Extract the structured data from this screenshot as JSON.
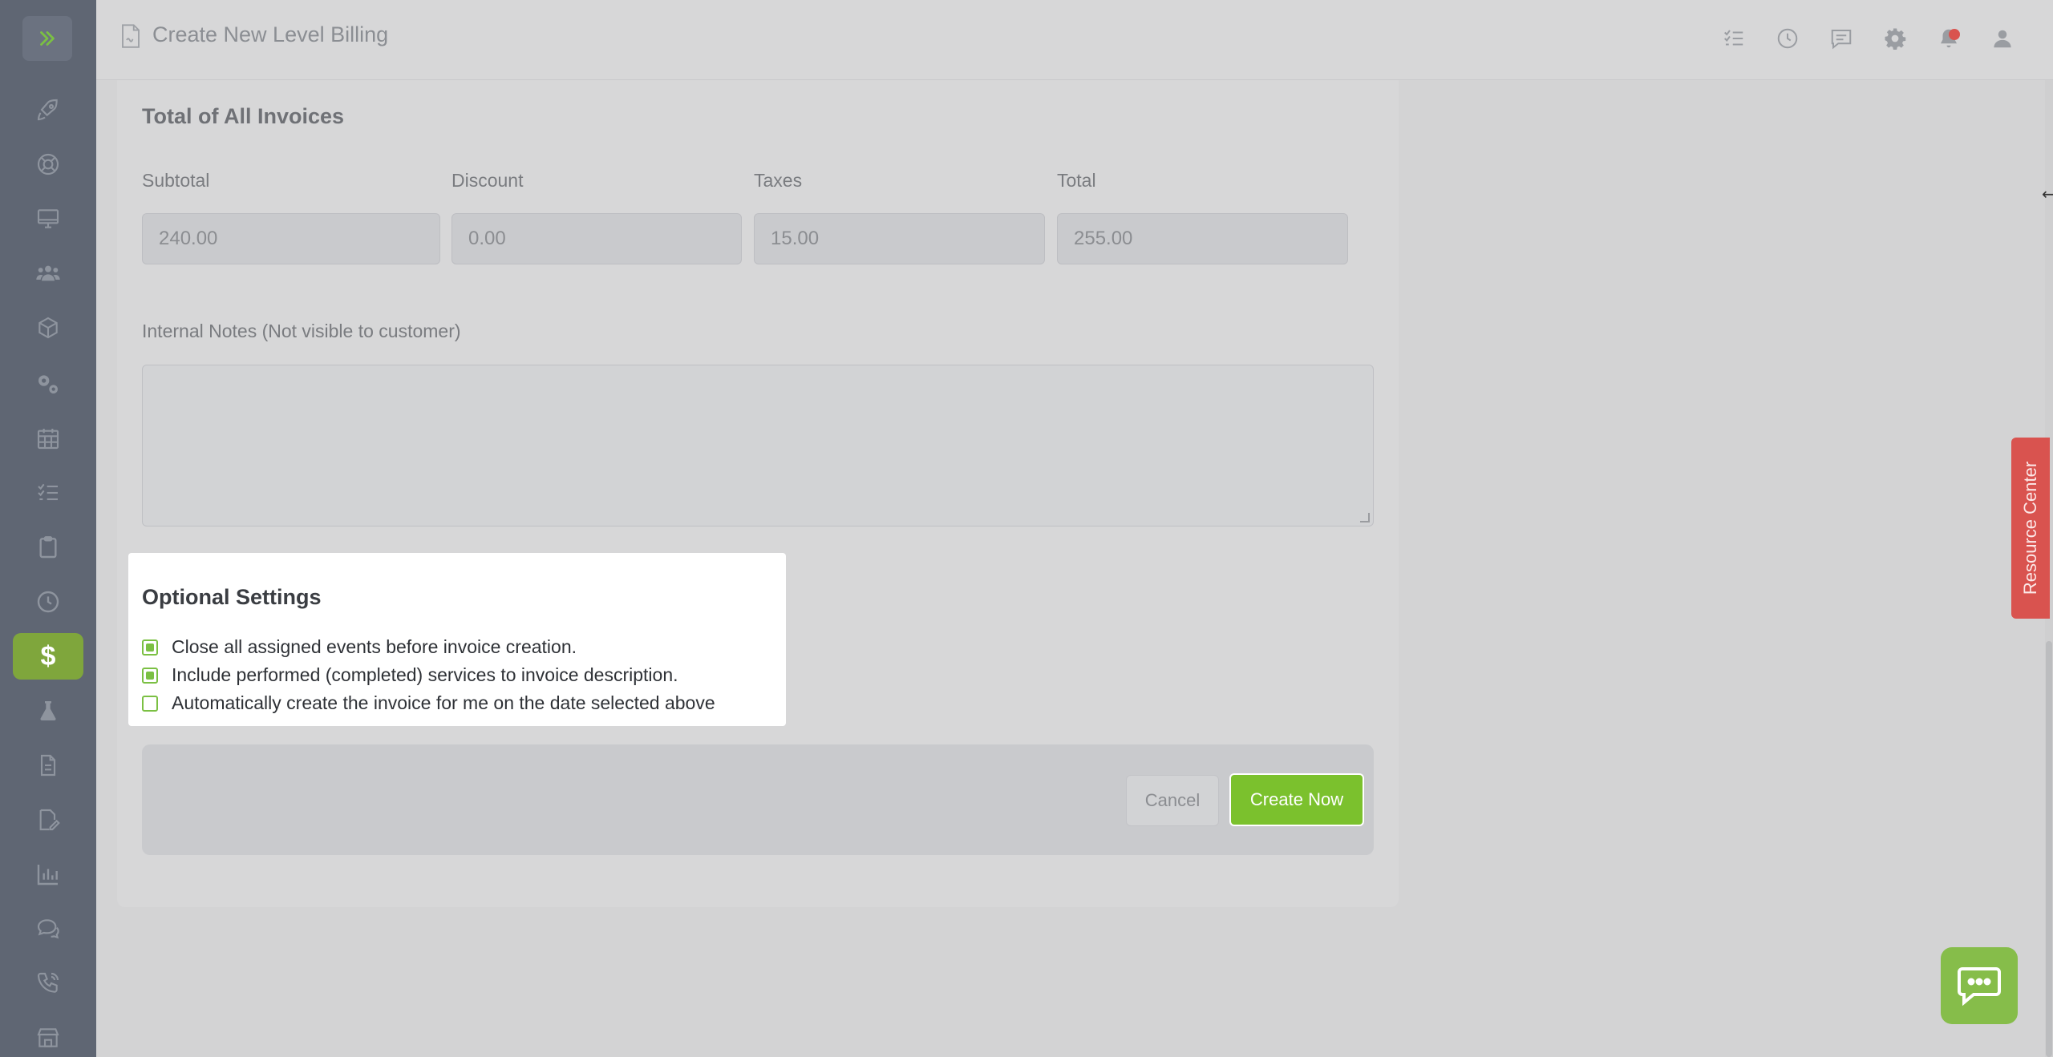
{
  "header": {
    "title": "Create New Level Billing"
  },
  "sidebar": {
    "items": [
      {
        "icon": "rocket-icon"
      },
      {
        "icon": "lifebuoy-icon"
      },
      {
        "icon": "monitor-icon"
      },
      {
        "icon": "users-icon"
      },
      {
        "icon": "box-icon"
      },
      {
        "icon": "gears-icon"
      },
      {
        "icon": "calendar-icon"
      },
      {
        "icon": "checklist-icon"
      },
      {
        "icon": "clipboard-icon"
      },
      {
        "icon": "clock-icon"
      },
      {
        "icon": "dollar-icon",
        "active": true,
        "glyph": "$"
      },
      {
        "icon": "flask-icon"
      },
      {
        "icon": "document-icon"
      },
      {
        "icon": "signature-icon"
      },
      {
        "icon": "chart-icon"
      },
      {
        "icon": "chat-icon"
      },
      {
        "icon": "phone-icon"
      },
      {
        "icon": "store-icon"
      }
    ]
  },
  "totals": {
    "title": "Total of All Invoices",
    "subtotal_label": "Subtotal",
    "subtotal_value": "240.00",
    "discount_label": "Discount",
    "discount_value": "0.00",
    "taxes_label": "Taxes",
    "taxes_value": "15.00",
    "total_label": "Total",
    "total_value": "255.00"
  },
  "notes": {
    "label": "Internal Notes (Not visible to customer)",
    "value": ""
  },
  "optional_settings": {
    "title": "Optional Settings",
    "options": [
      {
        "label": "Close all assigned events before invoice creation.",
        "checked": true
      },
      {
        "label": "Include performed (completed) services to invoice description.",
        "checked": true
      },
      {
        "label": "Automatically create the invoice for me on the date selected above",
        "checked": false
      }
    ]
  },
  "actions": {
    "cancel_label": "Cancel",
    "create_label": "Create Now"
  },
  "resource_center": {
    "label": "Resource Center"
  },
  "colors": {
    "accent_green": "#7bc12d",
    "sidebar": "#5f6673",
    "resource_red": "#d9534f"
  }
}
